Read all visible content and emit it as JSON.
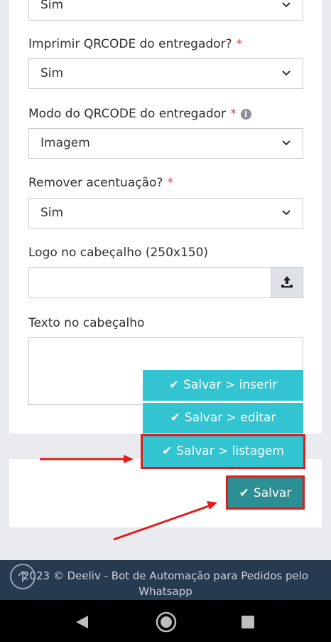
{
  "fields": {
    "top_select": {
      "value": "Sim"
    },
    "print_qrcode": {
      "label": "Imprimir QRCODE do entregador?",
      "required_mark": "*",
      "value": "Sim"
    },
    "qrcode_mode": {
      "label": "Modo do QRCODE do entregador",
      "required_mark": "*",
      "info_icon": "i",
      "value": "Imagem"
    },
    "remove_accent": {
      "label": "Remover acentuação?",
      "required_mark": "*",
      "value": "Sim"
    },
    "header_logo": {
      "label": "Logo no cabeçalho (250x150)",
      "value": ""
    },
    "header_text": {
      "label": "Texto no cabeçalho",
      "value": ""
    }
  },
  "save_menu": {
    "items": [
      {
        "label": "Salvar > inserir",
        "icon": "check-icon"
      },
      {
        "label": "Salvar > editar",
        "icon": "check-icon"
      },
      {
        "label": "Salvar > listagem",
        "icon": "check-icon"
      }
    ],
    "save_label": "Salvar"
  },
  "footer": {
    "line1": "2023 © Deeliv - Bot de Automação para Pedidos pelo",
    "line2": "Whatsapp"
  },
  "colors": {
    "accent": "#33c4d2",
    "save_button": "#2b8f93",
    "annotation": "#e31b1b",
    "required": "#e53935",
    "footer_bg": "#263a50"
  }
}
